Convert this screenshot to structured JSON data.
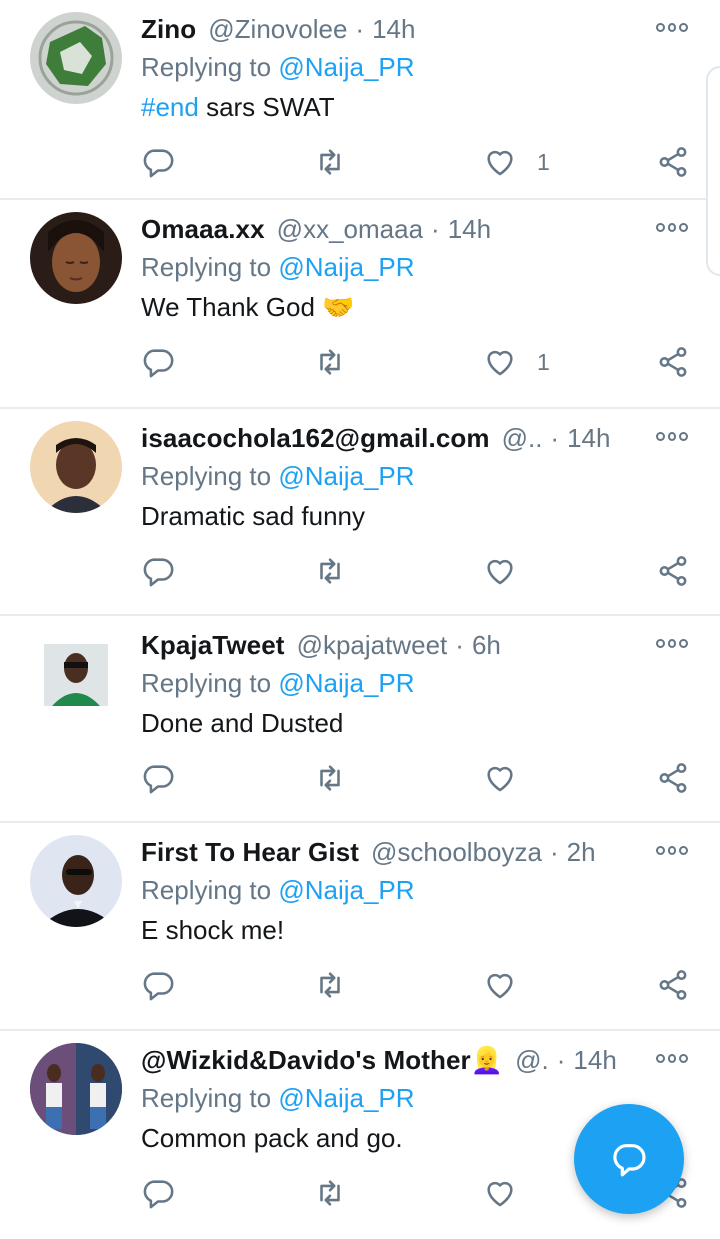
{
  "tweets": [
    {
      "name": "Zino",
      "handle": "@Zinovolee",
      "time": "14h",
      "replying_prefix": "Replying to ",
      "mention": "@Naija_PR",
      "hashtag": "#end",
      "text": " sars SWAT",
      "like_count": "1"
    },
    {
      "name": "Omaaa.xx",
      "handle": "@xx_omaaa",
      "time": "14h",
      "replying_prefix": "Replying to ",
      "mention": "@Naija_PR",
      "text": "We Thank God ",
      "emoji": "🤝",
      "like_count": "1"
    },
    {
      "name": "isaacochola162@gmail.com",
      "handle": "@..",
      "time": "14h",
      "replying_prefix": "Replying to ",
      "mention": "@Naija_PR",
      "text": "Dramatic sad funny",
      "like_count": ""
    },
    {
      "name": "KpajaTweet",
      "handle": "@kpajatweet",
      "time": "6h",
      "replying_prefix": "Replying to ",
      "mention": "@Naija_PR",
      "text": "Done and Dusted",
      "like_count": ""
    },
    {
      "name": "First To Hear Gist",
      "handle": "@schoolboyza",
      "time": "2h",
      "replying_prefix": "Replying to ",
      "mention": "@Naija_PR",
      "text": "E shock me!",
      "like_count": ""
    },
    {
      "name": "@Wizkid&Davido's Mother",
      "name_emoji": "👱‍♀️",
      "handle": "@.",
      "time": "14h",
      "replying_prefix": "Replying to ",
      "mention": "@Naija_PR",
      "text": "Common pack and go.",
      "like_count": ""
    }
  ],
  "separator": "·",
  "icons": {
    "reply": "reply-icon",
    "retweet": "retweet-icon",
    "like": "heart-icon",
    "share": "share-icon",
    "more": "more-icon",
    "compose": "compose-reply-icon"
  },
  "colors": {
    "accent": "#1da1f2",
    "secondary_text": "#657786",
    "primary_text": "#14171a",
    "divider": "#e6ecf0"
  }
}
